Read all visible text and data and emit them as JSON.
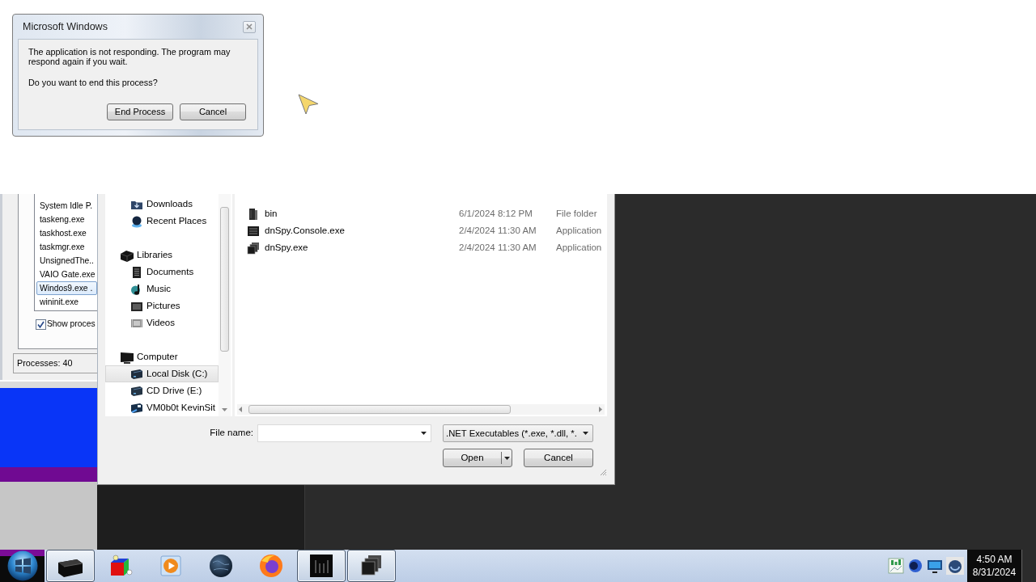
{
  "error_dialog": {
    "title": "Microsoft Windows",
    "message": "The application is not responding. The program may respond again if you wait.",
    "question": "Do you want to end this process?",
    "buttons": [
      {
        "label": "End Process"
      },
      {
        "label": "Cancel"
      }
    ]
  },
  "task_manager": {
    "processes": [
      {
        "name": "System Idle P.",
        "selected": false
      },
      {
        "name": "taskeng.exe",
        "selected": false
      },
      {
        "name": "taskhost.exe",
        "selected": false
      },
      {
        "name": "taskmgr.exe",
        "selected": false
      },
      {
        "name": "UnsignedThe..",
        "selected": false
      },
      {
        "name": "VAIO Gate.exe",
        "selected": false
      },
      {
        "name": "Windos9.exe .",
        "selected": true
      },
      {
        "name": "wininit.exe",
        "selected": false
      }
    ],
    "show_all": {
      "label": "Show proces",
      "checked": true
    },
    "status": "Processes: 40"
  },
  "open_dialog": {
    "nav_tree": [
      {
        "children": [
          {
            "label": "Downloads",
            "kind": "downloads",
            "selected": false
          },
          {
            "label": "Recent Places",
            "kind": "recent",
            "selected": false
          }
        ]
      },
      {
        "label": "Libraries",
        "kind": "libraries",
        "selected": false,
        "children": [
          {
            "label": "Documents",
            "kind": "documents",
            "selected": false
          },
          {
            "label": "Music",
            "kind": "music",
            "selected": false
          },
          {
            "label": "Pictures",
            "kind": "pictures",
            "selected": false
          },
          {
            "label": "Videos",
            "kind": "videos",
            "selected": false
          }
        ]
      },
      {
        "label": "Computer",
        "kind": "computer",
        "selected": false,
        "children": [
          {
            "label": "Local Disk (C:)",
            "kind": "disk",
            "selected": true
          },
          {
            "label": "CD Drive (E:)",
            "kind": "cd",
            "selected": false
          },
          {
            "label": "VM0b0t KevinSit",
            "kind": "network",
            "selected": false
          }
        ]
      }
    ],
    "files": [
      {
        "name": "bin",
        "date_modified": "6/1/2024 8:12 PM",
        "type": "File folder",
        "kind": "folder"
      },
      {
        "name": "dnSpy.Console.exe",
        "date_modified": "2/4/2024 11:30 AM",
        "type": "Application",
        "kind": "console"
      },
      {
        "name": "dnSpy.exe",
        "date_modified": "2/4/2024 11:30 AM",
        "type": "Application",
        "kind": "app"
      }
    ],
    "file_name_label": "File name:",
    "file_type": ".NET Executables (*.exe, *.dll, *.",
    "buttons": [
      {
        "label": "Open",
        "kind": "split"
      },
      {
        "label": "Cancel",
        "kind": "plain"
      }
    ]
  },
  "taskbar": {
    "apps": [
      {
        "kind": "box",
        "running": true
      },
      {
        "kind": "cube",
        "running": false
      },
      {
        "kind": "media",
        "running": false
      },
      {
        "kind": "globe",
        "running": false
      },
      {
        "kind": "browser",
        "running": false
      },
      {
        "kind": "bars",
        "running": true
      },
      {
        "kind": "windows",
        "running": true
      }
    ],
    "clock": {
      "time": "4:50 AM",
      "date": "8/31/2024"
    }
  }
}
